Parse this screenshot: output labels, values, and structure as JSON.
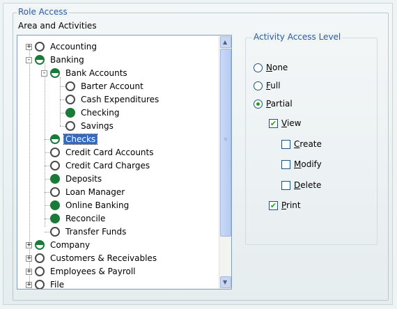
{
  "group_title": "Role Access",
  "area_label": "Area and Activities",
  "right_title": "Activity Access Level",
  "tree": [
    {
      "label": "Accounting",
      "state": "none",
      "expander": "+"
    },
    {
      "label": "Banking",
      "state": "partial",
      "expander": "-"
    },
    {
      "label": "Bank Accounts",
      "state": "partial",
      "expander": "-"
    },
    {
      "label": "Barter Account",
      "state": "none",
      "expander": ""
    },
    {
      "label": "Cash Expenditures",
      "state": "none",
      "expander": ""
    },
    {
      "label": "Checking",
      "state": "full",
      "expander": ""
    },
    {
      "label": "Savings",
      "state": "none",
      "expander": ""
    },
    {
      "label": "Checks",
      "state": "partial",
      "expander": "",
      "selected": true
    },
    {
      "label": "Credit Card Accounts",
      "state": "none",
      "expander": ""
    },
    {
      "label": "Credit Card Charges",
      "state": "none",
      "expander": ""
    },
    {
      "label": "Deposits",
      "state": "full",
      "expander": ""
    },
    {
      "label": "Loan Manager",
      "state": "none",
      "expander": ""
    },
    {
      "label": "Online Banking",
      "state": "full",
      "expander": ""
    },
    {
      "label": "Reconcile",
      "state": "full",
      "expander": ""
    },
    {
      "label": "Transfer Funds",
      "state": "none",
      "expander": ""
    },
    {
      "label": "Company",
      "state": "partial",
      "expander": "+"
    },
    {
      "label": "Customers & Receivables",
      "state": "none",
      "expander": "+"
    },
    {
      "label": "Employees & Payroll",
      "state": "none",
      "expander": "+"
    },
    {
      "label": "File",
      "state": "none",
      "expander": "+"
    }
  ],
  "radios": [
    {
      "first": "N",
      "rest": "one",
      "checked": false
    },
    {
      "first": "F",
      "rest": "ull",
      "checked": false
    },
    {
      "first": "P",
      "rest": "artial",
      "checked": true
    }
  ],
  "checks": [
    {
      "first": "V",
      "rest": "iew",
      "checked": true
    },
    {
      "first": "C",
      "rest": "reate",
      "checked": false
    },
    {
      "first": "M",
      "rest": "odify",
      "checked": false
    },
    {
      "first": "D",
      "rest": "elete",
      "checked": false
    },
    {
      "first": "P",
      "rest": "rint",
      "checked": true
    }
  ],
  "colors": {
    "full": "#1a7a3a",
    "selection": "#316ac5",
    "group_title": "#2c5aa0"
  },
  "icons": {
    "scroll_up": "▲",
    "scroll_down": "▼",
    "checkmark": "✔"
  }
}
